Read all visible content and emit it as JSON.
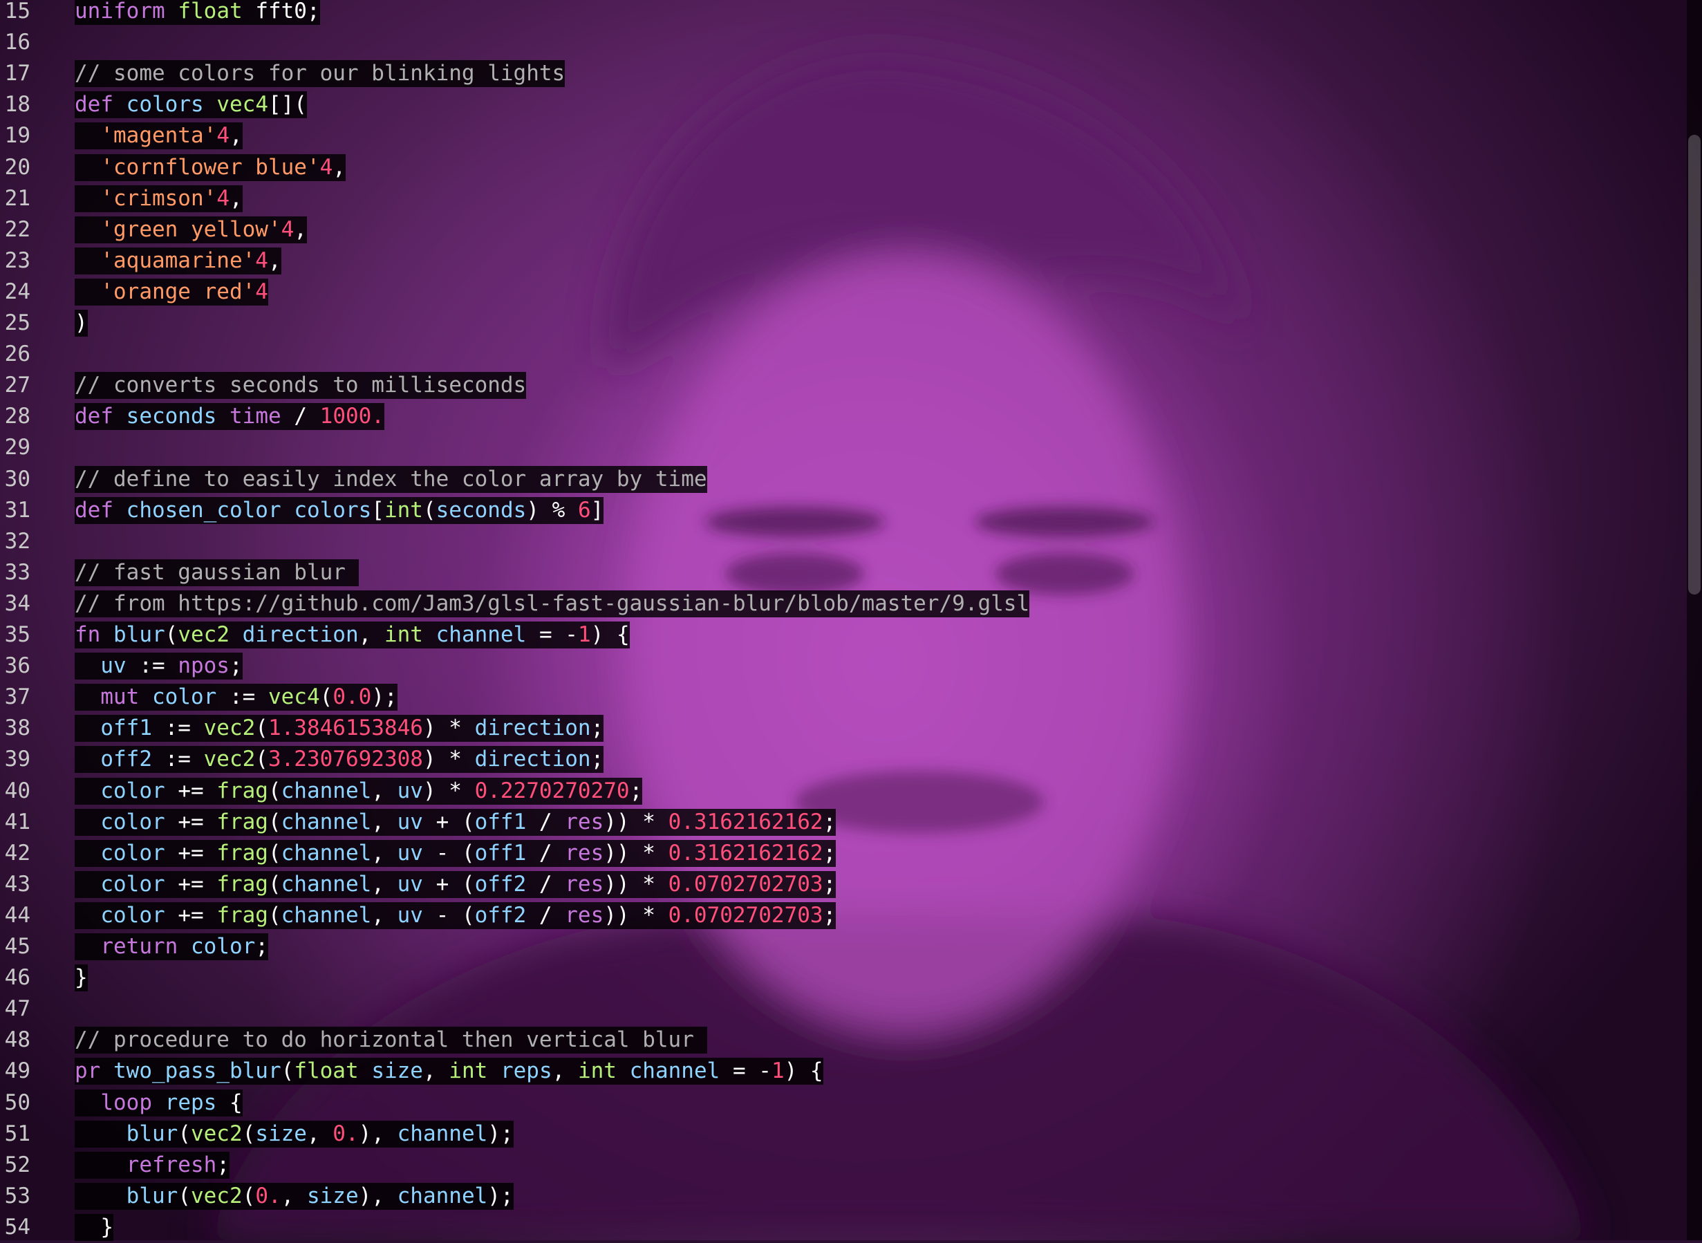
{
  "editor": {
    "lines": [
      {
        "n": "15",
        "tokens": [
          [
            "kw",
            "uniform"
          ],
          [
            "op",
            " "
          ],
          [
            "ty",
            "float"
          ],
          [
            "op",
            " fft0;"
          ]
        ]
      },
      {
        "n": "16",
        "tokens": []
      },
      {
        "n": "17",
        "tokens": [
          [
            "cm",
            "// some colors for our blinking lights"
          ]
        ]
      },
      {
        "n": "18",
        "tokens": [
          [
            "kw",
            "def"
          ],
          [
            "op",
            " "
          ],
          [
            "fnn",
            "colors"
          ],
          [
            "op",
            " "
          ],
          [
            "ty",
            "vec4"
          ],
          [
            "op",
            "[]("
          ]
        ]
      },
      {
        "n": "19",
        "tokens": [
          [
            "op",
            "  "
          ],
          [
            "str",
            "'magenta'"
          ],
          [
            "num",
            "4"
          ],
          [
            "op",
            ","
          ]
        ]
      },
      {
        "n": "20",
        "tokens": [
          [
            "op",
            "  "
          ],
          [
            "str",
            "'cornflower blue'"
          ],
          [
            "num",
            "4"
          ],
          [
            "op",
            ","
          ]
        ]
      },
      {
        "n": "21",
        "tokens": [
          [
            "op",
            "  "
          ],
          [
            "str",
            "'crimson'"
          ],
          [
            "num",
            "4"
          ],
          [
            "op",
            ","
          ]
        ]
      },
      {
        "n": "22",
        "tokens": [
          [
            "op",
            "  "
          ],
          [
            "str",
            "'green yellow'"
          ],
          [
            "num",
            "4"
          ],
          [
            "op",
            ","
          ]
        ]
      },
      {
        "n": "23",
        "tokens": [
          [
            "op",
            "  "
          ],
          [
            "str",
            "'aquamarine'"
          ],
          [
            "num",
            "4"
          ],
          [
            "op",
            ","
          ]
        ]
      },
      {
        "n": "24",
        "tokens": [
          [
            "op",
            "  "
          ],
          [
            "str",
            "'orange red'"
          ],
          [
            "num",
            "4"
          ]
        ]
      },
      {
        "n": "25",
        "tokens": [
          [
            "op",
            ")"
          ]
        ]
      },
      {
        "n": "26",
        "tokens": []
      },
      {
        "n": "27",
        "tokens": [
          [
            "cm",
            "// converts seconds to milliseconds"
          ]
        ]
      },
      {
        "n": "28",
        "tokens": [
          [
            "kw",
            "def"
          ],
          [
            "op",
            " "
          ],
          [
            "fnn",
            "seconds"
          ],
          [
            "op",
            " "
          ],
          [
            "kw",
            "time"
          ],
          [
            "op",
            " / "
          ],
          [
            "num",
            "1000."
          ]
        ]
      },
      {
        "n": "29",
        "tokens": []
      },
      {
        "n": "30",
        "tokens": [
          [
            "cm",
            "// define to easily index the color array by time"
          ]
        ]
      },
      {
        "n": "31",
        "tokens": [
          [
            "kw",
            "def"
          ],
          [
            "op",
            " "
          ],
          [
            "fnn",
            "chosen_color"
          ],
          [
            "op",
            " "
          ],
          [
            "fnn",
            "colors"
          ],
          [
            "op",
            "["
          ],
          [
            "ty",
            "int"
          ],
          [
            "op",
            "("
          ],
          [
            "fnn",
            "seconds"
          ],
          [
            "op",
            ") % "
          ],
          [
            "num",
            "6"
          ],
          [
            "op",
            "]"
          ]
        ]
      },
      {
        "n": "32",
        "tokens": []
      },
      {
        "n": "33",
        "tokens": [
          [
            "cm",
            "// fast gaussian blur "
          ]
        ]
      },
      {
        "n": "34",
        "tokens": [
          [
            "cm",
            "// from https://github.com/Jam3/glsl-fast-gaussian-blur/blob/master/9.glsl"
          ]
        ]
      },
      {
        "n": "35",
        "tokens": [
          [
            "kw",
            "fn"
          ],
          [
            "op",
            " "
          ],
          [
            "fnn",
            "blur"
          ],
          [
            "op",
            "("
          ],
          [
            "ty",
            "vec2"
          ],
          [
            "op",
            " "
          ],
          [
            "fnn",
            "direction"
          ],
          [
            "op",
            ", "
          ],
          [
            "ty",
            "int"
          ],
          [
            "op",
            " "
          ],
          [
            "fnn",
            "channel"
          ],
          [
            "op",
            " = -"
          ],
          [
            "num",
            "1"
          ],
          [
            "op",
            ") {"
          ]
        ]
      },
      {
        "n": "36",
        "tokens": [
          [
            "op",
            "  "
          ],
          [
            "fnn",
            "uv"
          ],
          [
            "op",
            " := "
          ],
          [
            "kw",
            "npos"
          ],
          [
            "op",
            ";"
          ]
        ]
      },
      {
        "n": "37",
        "tokens": [
          [
            "op",
            "  "
          ],
          [
            "kw",
            "mut"
          ],
          [
            "op",
            " "
          ],
          [
            "fnn",
            "color"
          ],
          [
            "op",
            " := "
          ],
          [
            "ty",
            "vec4"
          ],
          [
            "op",
            "("
          ],
          [
            "num",
            "0.0"
          ],
          [
            "op",
            ");"
          ]
        ]
      },
      {
        "n": "38",
        "tokens": [
          [
            "op",
            "  "
          ],
          [
            "fnn",
            "off1"
          ],
          [
            "op",
            " := "
          ],
          [
            "ty",
            "vec2"
          ],
          [
            "op",
            "("
          ],
          [
            "num",
            "1.3846153846"
          ],
          [
            "op",
            ") * "
          ],
          [
            "fnn",
            "direction"
          ],
          [
            "op",
            ";"
          ]
        ]
      },
      {
        "n": "39",
        "tokens": [
          [
            "op",
            "  "
          ],
          [
            "fnn",
            "off2"
          ],
          [
            "op",
            " := "
          ],
          [
            "ty",
            "vec2"
          ],
          [
            "op",
            "("
          ],
          [
            "num",
            "3.2307692308"
          ],
          [
            "op",
            ") * "
          ],
          [
            "fnn",
            "direction"
          ],
          [
            "op",
            ";"
          ]
        ]
      },
      {
        "n": "40",
        "tokens": [
          [
            "op",
            "  "
          ],
          [
            "fnn",
            "color"
          ],
          [
            "op",
            " += "
          ],
          [
            "ty",
            "frag"
          ],
          [
            "op",
            "("
          ],
          [
            "fnn",
            "channel"
          ],
          [
            "op",
            ", "
          ],
          [
            "fnn",
            "uv"
          ],
          [
            "op",
            ") * "
          ],
          [
            "num",
            "0.2270270270"
          ],
          [
            "op",
            ";"
          ]
        ]
      },
      {
        "n": "41",
        "tokens": [
          [
            "op",
            "  "
          ],
          [
            "fnn",
            "color"
          ],
          [
            "op",
            " += "
          ],
          [
            "ty",
            "frag"
          ],
          [
            "op",
            "("
          ],
          [
            "fnn",
            "channel"
          ],
          [
            "op",
            ", "
          ],
          [
            "fnn",
            "uv"
          ],
          [
            "op",
            " + ("
          ],
          [
            "fnn",
            "off1"
          ],
          [
            "op",
            " / "
          ],
          [
            "kw",
            "res"
          ],
          [
            "op",
            ")) * "
          ],
          [
            "num",
            "0.3162162162"
          ],
          [
            "op",
            ";"
          ]
        ]
      },
      {
        "n": "42",
        "tokens": [
          [
            "op",
            "  "
          ],
          [
            "fnn",
            "color"
          ],
          [
            "op",
            " += "
          ],
          [
            "ty",
            "frag"
          ],
          [
            "op",
            "("
          ],
          [
            "fnn",
            "channel"
          ],
          [
            "op",
            ", "
          ],
          [
            "fnn",
            "uv"
          ],
          [
            "op",
            " - ("
          ],
          [
            "fnn",
            "off1"
          ],
          [
            "op",
            " / "
          ],
          [
            "kw",
            "res"
          ],
          [
            "op",
            ")) * "
          ],
          [
            "num",
            "0.3162162162"
          ],
          [
            "op",
            ";"
          ]
        ]
      },
      {
        "n": "43",
        "tokens": [
          [
            "op",
            "  "
          ],
          [
            "fnn",
            "color"
          ],
          [
            "op",
            " += "
          ],
          [
            "ty",
            "frag"
          ],
          [
            "op",
            "("
          ],
          [
            "fnn",
            "channel"
          ],
          [
            "op",
            ", "
          ],
          [
            "fnn",
            "uv"
          ],
          [
            "op",
            " + ("
          ],
          [
            "fnn",
            "off2"
          ],
          [
            "op",
            " / "
          ],
          [
            "kw",
            "res"
          ],
          [
            "op",
            ")) * "
          ],
          [
            "num",
            "0.0702702703"
          ],
          [
            "op",
            ";"
          ]
        ]
      },
      {
        "n": "44",
        "tokens": [
          [
            "op",
            "  "
          ],
          [
            "fnn",
            "color"
          ],
          [
            "op",
            " += "
          ],
          [
            "ty",
            "frag"
          ],
          [
            "op",
            "("
          ],
          [
            "fnn",
            "channel"
          ],
          [
            "op",
            ", "
          ],
          [
            "fnn",
            "uv"
          ],
          [
            "op",
            " - ("
          ],
          [
            "fnn",
            "off2"
          ],
          [
            "op",
            " / "
          ],
          [
            "kw",
            "res"
          ],
          [
            "op",
            ")) * "
          ],
          [
            "num",
            "0.0702702703"
          ],
          [
            "op",
            ";"
          ]
        ]
      },
      {
        "n": "45",
        "tokens": [
          [
            "op",
            "  "
          ],
          [
            "kw",
            "return"
          ],
          [
            "op",
            " "
          ],
          [
            "fnn",
            "color"
          ],
          [
            "op",
            ";"
          ]
        ]
      },
      {
        "n": "46",
        "tokens": [
          [
            "op",
            "}"
          ]
        ]
      },
      {
        "n": "47",
        "tokens": []
      },
      {
        "n": "48",
        "tokens": [
          [
            "cm",
            "// procedure to do horizontal then vertical blur "
          ]
        ]
      },
      {
        "n": "49",
        "tokens": [
          [
            "kw",
            "pr"
          ],
          [
            "op",
            " "
          ],
          [
            "fnn",
            "two_pass_blur"
          ],
          [
            "op",
            "("
          ],
          [
            "ty",
            "float"
          ],
          [
            "op",
            " "
          ],
          [
            "fnn",
            "size"
          ],
          [
            "op",
            ", "
          ],
          [
            "ty",
            "int"
          ],
          [
            "op",
            " "
          ],
          [
            "fnn",
            "reps"
          ],
          [
            "op",
            ", "
          ],
          [
            "ty",
            "int"
          ],
          [
            "op",
            " "
          ],
          [
            "fnn",
            "channel"
          ],
          [
            "op",
            " = -"
          ],
          [
            "num",
            "1"
          ],
          [
            "op",
            ") {"
          ]
        ]
      },
      {
        "n": "50",
        "tokens": [
          [
            "op",
            "  "
          ],
          [
            "kw",
            "loop"
          ],
          [
            "op",
            " "
          ],
          [
            "fnn",
            "reps"
          ],
          [
            "op",
            " {"
          ]
        ]
      },
      {
        "n": "51",
        "tokens": [
          [
            "op",
            "    "
          ],
          [
            "fnn",
            "blur"
          ],
          [
            "op",
            "("
          ],
          [
            "ty",
            "vec2"
          ],
          [
            "op",
            "("
          ],
          [
            "fnn",
            "size"
          ],
          [
            "op",
            ", "
          ],
          [
            "num",
            "0."
          ],
          [
            "op",
            "), "
          ],
          [
            "fnn",
            "channel"
          ],
          [
            "op",
            ");"
          ]
        ]
      },
      {
        "n": "52",
        "tokens": [
          [
            "op",
            "    "
          ],
          [
            "kw",
            "refresh"
          ],
          [
            "op",
            ";"
          ]
        ]
      },
      {
        "n": "53",
        "tokens": [
          [
            "op",
            "    "
          ],
          [
            "fnn",
            "blur"
          ],
          [
            "op",
            "("
          ],
          [
            "ty",
            "vec2"
          ],
          [
            "op",
            "("
          ],
          [
            "num",
            "0."
          ],
          [
            "op",
            ", "
          ],
          [
            "fnn",
            "size"
          ],
          [
            "op",
            "), "
          ],
          [
            "fnn",
            "channel"
          ],
          [
            "op",
            ");"
          ]
        ]
      },
      {
        "n": "54",
        "tokens": [
          [
            "op",
            "  }"
          ]
        ]
      }
    ]
  },
  "colors": {
    "keyword": "#c678dd",
    "type": "#b6f07a",
    "identifier": "#8fd3ff",
    "string": "#ff9a66",
    "number": "#ff4f7b",
    "comment": "#b0b0b0",
    "overlay_tint": "#c85ad2"
  }
}
